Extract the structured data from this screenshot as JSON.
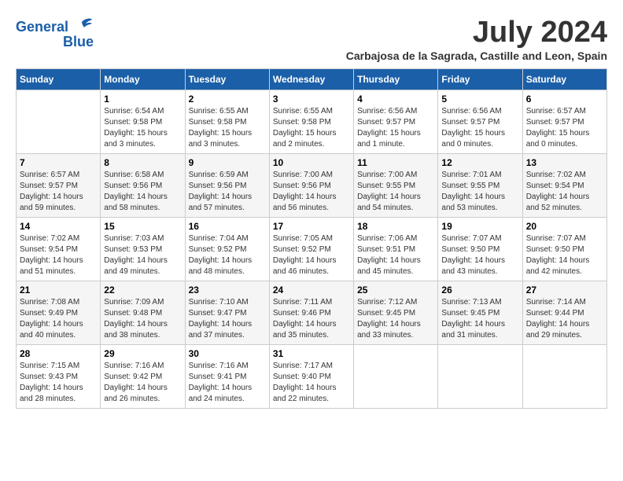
{
  "logo": {
    "line1": "General",
    "line2": "Blue"
  },
  "title": "July 2024",
  "location": "Carbajosa de la Sagrada, Castille and Leon, Spain",
  "days_of_week": [
    "Sunday",
    "Monday",
    "Tuesday",
    "Wednesday",
    "Thursday",
    "Friday",
    "Saturday"
  ],
  "weeks": [
    [
      {
        "day": "",
        "info": ""
      },
      {
        "day": "1",
        "info": "Sunrise: 6:54 AM\nSunset: 9:58 PM\nDaylight: 15 hours\nand 3 minutes."
      },
      {
        "day": "2",
        "info": "Sunrise: 6:55 AM\nSunset: 9:58 PM\nDaylight: 15 hours\nand 3 minutes."
      },
      {
        "day": "3",
        "info": "Sunrise: 6:55 AM\nSunset: 9:58 PM\nDaylight: 15 hours\nand 2 minutes."
      },
      {
        "day": "4",
        "info": "Sunrise: 6:56 AM\nSunset: 9:57 PM\nDaylight: 15 hours\nand 1 minute."
      },
      {
        "day": "5",
        "info": "Sunrise: 6:56 AM\nSunset: 9:57 PM\nDaylight: 15 hours\nand 0 minutes."
      },
      {
        "day": "6",
        "info": "Sunrise: 6:57 AM\nSunset: 9:57 PM\nDaylight: 15 hours\nand 0 minutes."
      }
    ],
    [
      {
        "day": "7",
        "info": "Sunrise: 6:57 AM\nSunset: 9:57 PM\nDaylight: 14 hours\nand 59 minutes."
      },
      {
        "day": "8",
        "info": "Sunrise: 6:58 AM\nSunset: 9:56 PM\nDaylight: 14 hours\nand 58 minutes."
      },
      {
        "day": "9",
        "info": "Sunrise: 6:59 AM\nSunset: 9:56 PM\nDaylight: 14 hours\nand 57 minutes."
      },
      {
        "day": "10",
        "info": "Sunrise: 7:00 AM\nSunset: 9:56 PM\nDaylight: 14 hours\nand 56 minutes."
      },
      {
        "day": "11",
        "info": "Sunrise: 7:00 AM\nSunset: 9:55 PM\nDaylight: 14 hours\nand 54 minutes."
      },
      {
        "day": "12",
        "info": "Sunrise: 7:01 AM\nSunset: 9:55 PM\nDaylight: 14 hours\nand 53 minutes."
      },
      {
        "day": "13",
        "info": "Sunrise: 7:02 AM\nSunset: 9:54 PM\nDaylight: 14 hours\nand 52 minutes."
      }
    ],
    [
      {
        "day": "14",
        "info": "Sunrise: 7:02 AM\nSunset: 9:54 PM\nDaylight: 14 hours\nand 51 minutes."
      },
      {
        "day": "15",
        "info": "Sunrise: 7:03 AM\nSunset: 9:53 PM\nDaylight: 14 hours\nand 49 minutes."
      },
      {
        "day": "16",
        "info": "Sunrise: 7:04 AM\nSunset: 9:52 PM\nDaylight: 14 hours\nand 48 minutes."
      },
      {
        "day": "17",
        "info": "Sunrise: 7:05 AM\nSunset: 9:52 PM\nDaylight: 14 hours\nand 46 minutes."
      },
      {
        "day": "18",
        "info": "Sunrise: 7:06 AM\nSunset: 9:51 PM\nDaylight: 14 hours\nand 45 minutes."
      },
      {
        "day": "19",
        "info": "Sunrise: 7:07 AM\nSunset: 9:50 PM\nDaylight: 14 hours\nand 43 minutes."
      },
      {
        "day": "20",
        "info": "Sunrise: 7:07 AM\nSunset: 9:50 PM\nDaylight: 14 hours\nand 42 minutes."
      }
    ],
    [
      {
        "day": "21",
        "info": "Sunrise: 7:08 AM\nSunset: 9:49 PM\nDaylight: 14 hours\nand 40 minutes."
      },
      {
        "day": "22",
        "info": "Sunrise: 7:09 AM\nSunset: 9:48 PM\nDaylight: 14 hours\nand 38 minutes."
      },
      {
        "day": "23",
        "info": "Sunrise: 7:10 AM\nSunset: 9:47 PM\nDaylight: 14 hours\nand 37 minutes."
      },
      {
        "day": "24",
        "info": "Sunrise: 7:11 AM\nSunset: 9:46 PM\nDaylight: 14 hours\nand 35 minutes."
      },
      {
        "day": "25",
        "info": "Sunrise: 7:12 AM\nSunset: 9:45 PM\nDaylight: 14 hours\nand 33 minutes."
      },
      {
        "day": "26",
        "info": "Sunrise: 7:13 AM\nSunset: 9:45 PM\nDaylight: 14 hours\nand 31 minutes."
      },
      {
        "day": "27",
        "info": "Sunrise: 7:14 AM\nSunset: 9:44 PM\nDaylight: 14 hours\nand 29 minutes."
      }
    ],
    [
      {
        "day": "28",
        "info": "Sunrise: 7:15 AM\nSunset: 9:43 PM\nDaylight: 14 hours\nand 28 minutes."
      },
      {
        "day": "29",
        "info": "Sunrise: 7:16 AM\nSunset: 9:42 PM\nDaylight: 14 hours\nand 26 minutes."
      },
      {
        "day": "30",
        "info": "Sunrise: 7:16 AM\nSunset: 9:41 PM\nDaylight: 14 hours\nand 24 minutes."
      },
      {
        "day": "31",
        "info": "Sunrise: 7:17 AM\nSunset: 9:40 PM\nDaylight: 14 hours\nand 22 minutes."
      },
      {
        "day": "",
        "info": ""
      },
      {
        "day": "",
        "info": ""
      },
      {
        "day": "",
        "info": ""
      }
    ]
  ]
}
